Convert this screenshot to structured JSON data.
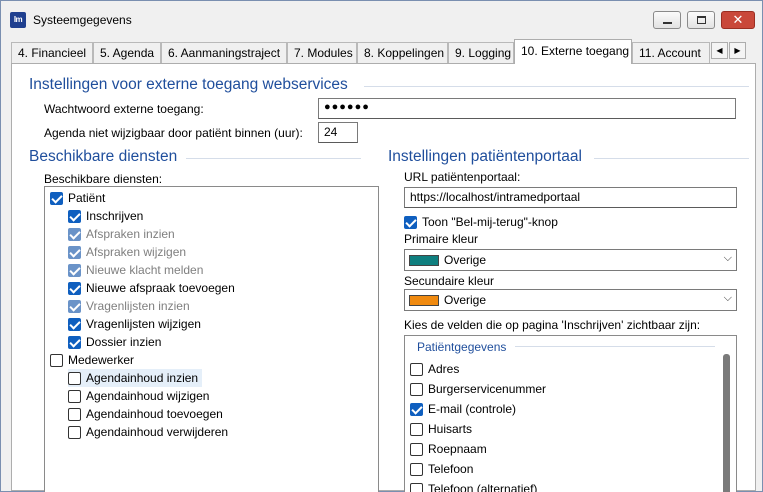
{
  "window": {
    "title": "Systeemgegevens",
    "app_icon_text": "Im"
  },
  "tabs": [
    {
      "label": "4. Financieel"
    },
    {
      "label": "5. Agenda"
    },
    {
      "label": "6. Aanmaningstraject"
    },
    {
      "label": "7. Modules"
    },
    {
      "label": "8. Koppelingen"
    },
    {
      "label": "9. Logging"
    },
    {
      "label": "10. Externe toegang"
    },
    {
      "label": "11. Account"
    }
  ],
  "active_tab": "10. Externe toegang",
  "webservices": {
    "title": "Instellingen voor externe toegang webservices",
    "password_label": "Wachtwoord externe toegang:",
    "password_value": "●●●●●●",
    "agenda_label": "Agenda niet wijzigbaar door patiënt binnen (uur):",
    "agenda_value": "24"
  },
  "services": {
    "title": "Beschikbare diensten",
    "list_label": "Beschikbare diensten:",
    "items": [
      {
        "label": "Patiënt",
        "checked": true,
        "level": 0,
        "dim": false
      },
      {
        "label": "Inschrijven",
        "checked": true,
        "level": 1,
        "dim": false
      },
      {
        "label": "Afspraken inzien",
        "checked": true,
        "level": 1,
        "dim": true
      },
      {
        "label": "Afspraken wijzigen",
        "checked": true,
        "level": 1,
        "dim": true
      },
      {
        "label": "Nieuwe klacht melden",
        "checked": true,
        "level": 1,
        "dim": true
      },
      {
        "label": "Nieuwe afspraak toevoegen",
        "checked": true,
        "level": 1,
        "dim": false
      },
      {
        "label": "Vragenlijsten inzien",
        "checked": true,
        "level": 1,
        "dim": true
      },
      {
        "label": "Vragenlijsten wijzigen",
        "checked": true,
        "level": 1,
        "dim": false
      },
      {
        "label": "Dossier inzien",
        "checked": true,
        "level": 1,
        "dim": false
      },
      {
        "label": "Medewerker",
        "checked": false,
        "level": 0,
        "dim": false
      },
      {
        "label": "Agendainhoud inzien",
        "checked": false,
        "level": 1,
        "dim": false,
        "selected": true
      },
      {
        "label": "Agendainhoud wijzigen",
        "checked": false,
        "level": 1,
        "dim": false
      },
      {
        "label": "Agendainhoud toevoegen",
        "checked": false,
        "level": 1,
        "dim": false
      },
      {
        "label": "Agendainhoud verwijderen",
        "checked": false,
        "level": 1,
        "dim": false
      }
    ]
  },
  "portal": {
    "title": "Instellingen patiëntenportaal",
    "url_label": "URL patiëntenportaal:",
    "url_value": "https://localhost/intramedportaal",
    "callback_label": "Toon \"Bel-mij-terug\"-knop",
    "callback_checked": true,
    "primary_label": "Primaire kleur",
    "primary_value": "Overige",
    "primary_color": "#0f7f7f",
    "secondary_label": "Secundaire kleur",
    "secondary_value": "Overige",
    "secondary_color": "#f08a10",
    "fields_label": "Kies de velden die op pagina 'Inschrijven' zichtbaar zijn:",
    "fieldset_title": "Patiëntgegevens",
    "fields": [
      {
        "label": "Adres",
        "checked": false
      },
      {
        "label": "Burgerservicenummer",
        "checked": false
      },
      {
        "label": "E-mail (controle)",
        "checked": true
      },
      {
        "label": "Huisarts",
        "checked": false
      },
      {
        "label": "Roepnaam",
        "checked": false
      },
      {
        "label": "Telefoon",
        "checked": false
      },
      {
        "label": "Telefoon (alternatief)",
        "checked": false
      }
    ]
  },
  "icons": {
    "minimize": "minimize-icon",
    "maximize": "maximize-icon",
    "close": "close-icon",
    "tab_left": "chevron-left-icon",
    "tab_right": "chevron-right-icon",
    "dropdown": "chevron-down-icon"
  }
}
